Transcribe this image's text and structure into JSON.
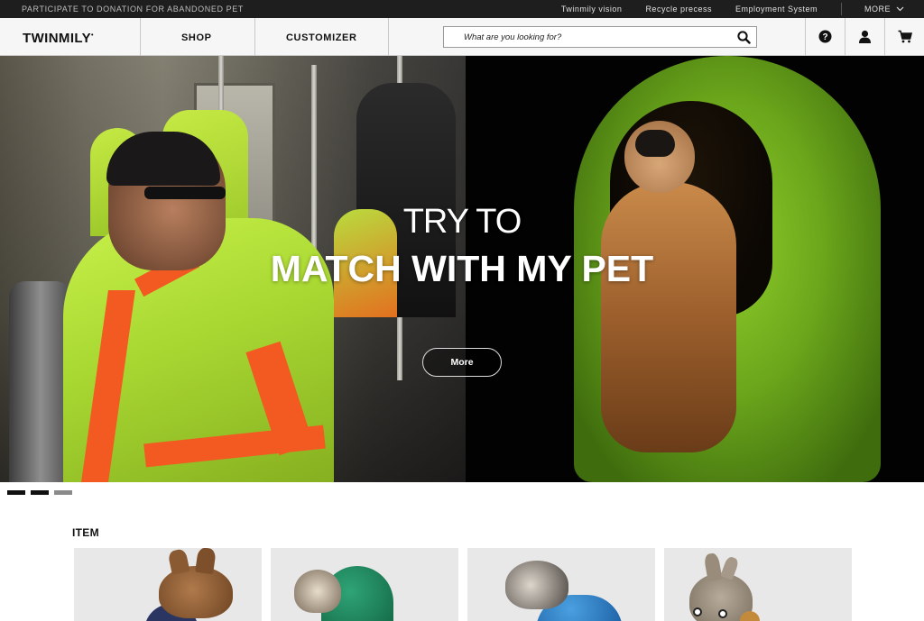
{
  "topbar": {
    "promo": "PARTICIPATE TO DONATION FOR ABANDONED PET",
    "links": [
      "Twinmily vision",
      "Recycle precess",
      "Employment System"
    ],
    "more_label": "MORE"
  },
  "header": {
    "logo": "TWINMILY",
    "nav": {
      "shop": "SHOP",
      "customizer": "CUSTOMIZER"
    },
    "search_placeholder": "What are you looking for?",
    "icons": [
      "search-icon",
      "help-icon",
      "user-icon",
      "cart-icon"
    ]
  },
  "hero": {
    "line1": "TRY TO",
    "line2": "MATCH WITH MY PET",
    "button_label": "More",
    "slides": 3,
    "active_slide": 1
  },
  "items": {
    "heading": "ITEM"
  },
  "colors": {
    "topbar_bg": "#1e1e1e",
    "neon_green": "#a9d832",
    "safety_orange": "#f25a22",
    "coat_green": "#6aa51b"
  }
}
